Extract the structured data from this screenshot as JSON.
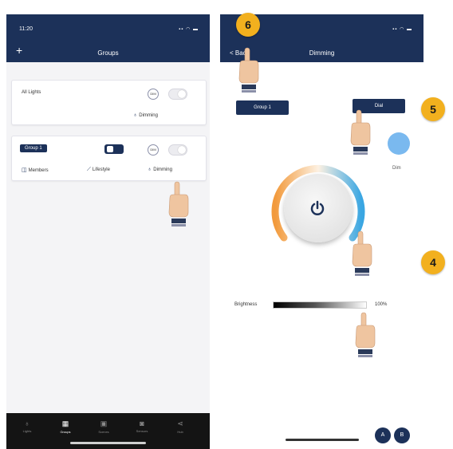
{
  "left_screen": {
    "status_time": "11:20",
    "status_icons": "▪▪ ◠ ▬",
    "title": "Groups",
    "add_icon": "plus-icon",
    "all_lights_card": {
      "label": "All Lights",
      "mode_label": "Dimming",
      "toggle_on": false
    },
    "group_card": {
      "group_name": "Group 1",
      "toggle_on": false,
      "actions": [
        {
          "label": "Members",
          "icon": "members-icon"
        },
        {
          "label": "Lifestyle",
          "icon": "wrench-icon"
        },
        {
          "label": "Dimming",
          "icon": "bulb-icon"
        }
      ]
    },
    "tabs": [
      {
        "label": "Lights",
        "icon": "bulb-icon",
        "active": false
      },
      {
        "label": "Groups",
        "icon": "groups-icon",
        "active": true
      },
      {
        "label": "Scenes",
        "icon": "scenes-icon",
        "active": false
      },
      {
        "label": "Sensors",
        "icon": "sensors-icon",
        "active": false
      },
      {
        "label": "Hub",
        "icon": "share-icon",
        "active": false
      }
    ]
  },
  "right_screen": {
    "status_icons": "▪▪ ◠ ▬",
    "title": "Dimming",
    "back_label": "< Back",
    "group_button": "Group 1",
    "apply_button": "Dial",
    "color_label": "Dim",
    "brightness_label": "Brightness",
    "brightness_value": "100%",
    "brightness_fraction": 1.0,
    "bottom_buttons": [
      "A",
      "B"
    ]
  },
  "annotations": {
    "step_6": "6",
    "step_5": "5",
    "step_4": "4"
  },
  "colors": {
    "header": "#1c3159",
    "badge": "#f2b01e",
    "warm_arc": "#f29a3c",
    "cool_arc": "#3aa6e2",
    "swatch": "#7ab9ef"
  }
}
